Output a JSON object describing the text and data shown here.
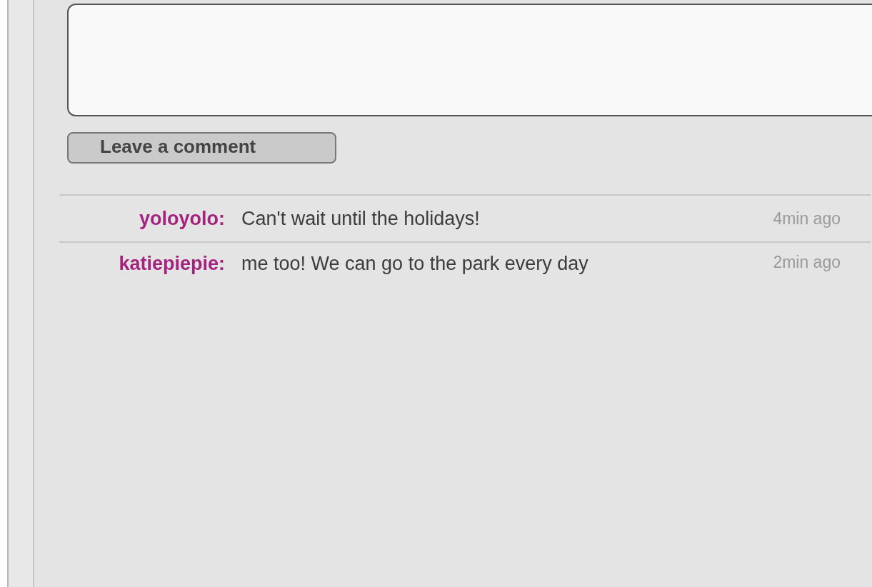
{
  "submit_button": {
    "label": "Leave a comment"
  },
  "comments": [
    {
      "user": "yoloyolo:",
      "text": "Can't wait until the holidays!",
      "time": "4min ago"
    },
    {
      "user": "katiepiepie:",
      "text": "me too! We can go to the park every day",
      "time": "2min ago"
    }
  ]
}
